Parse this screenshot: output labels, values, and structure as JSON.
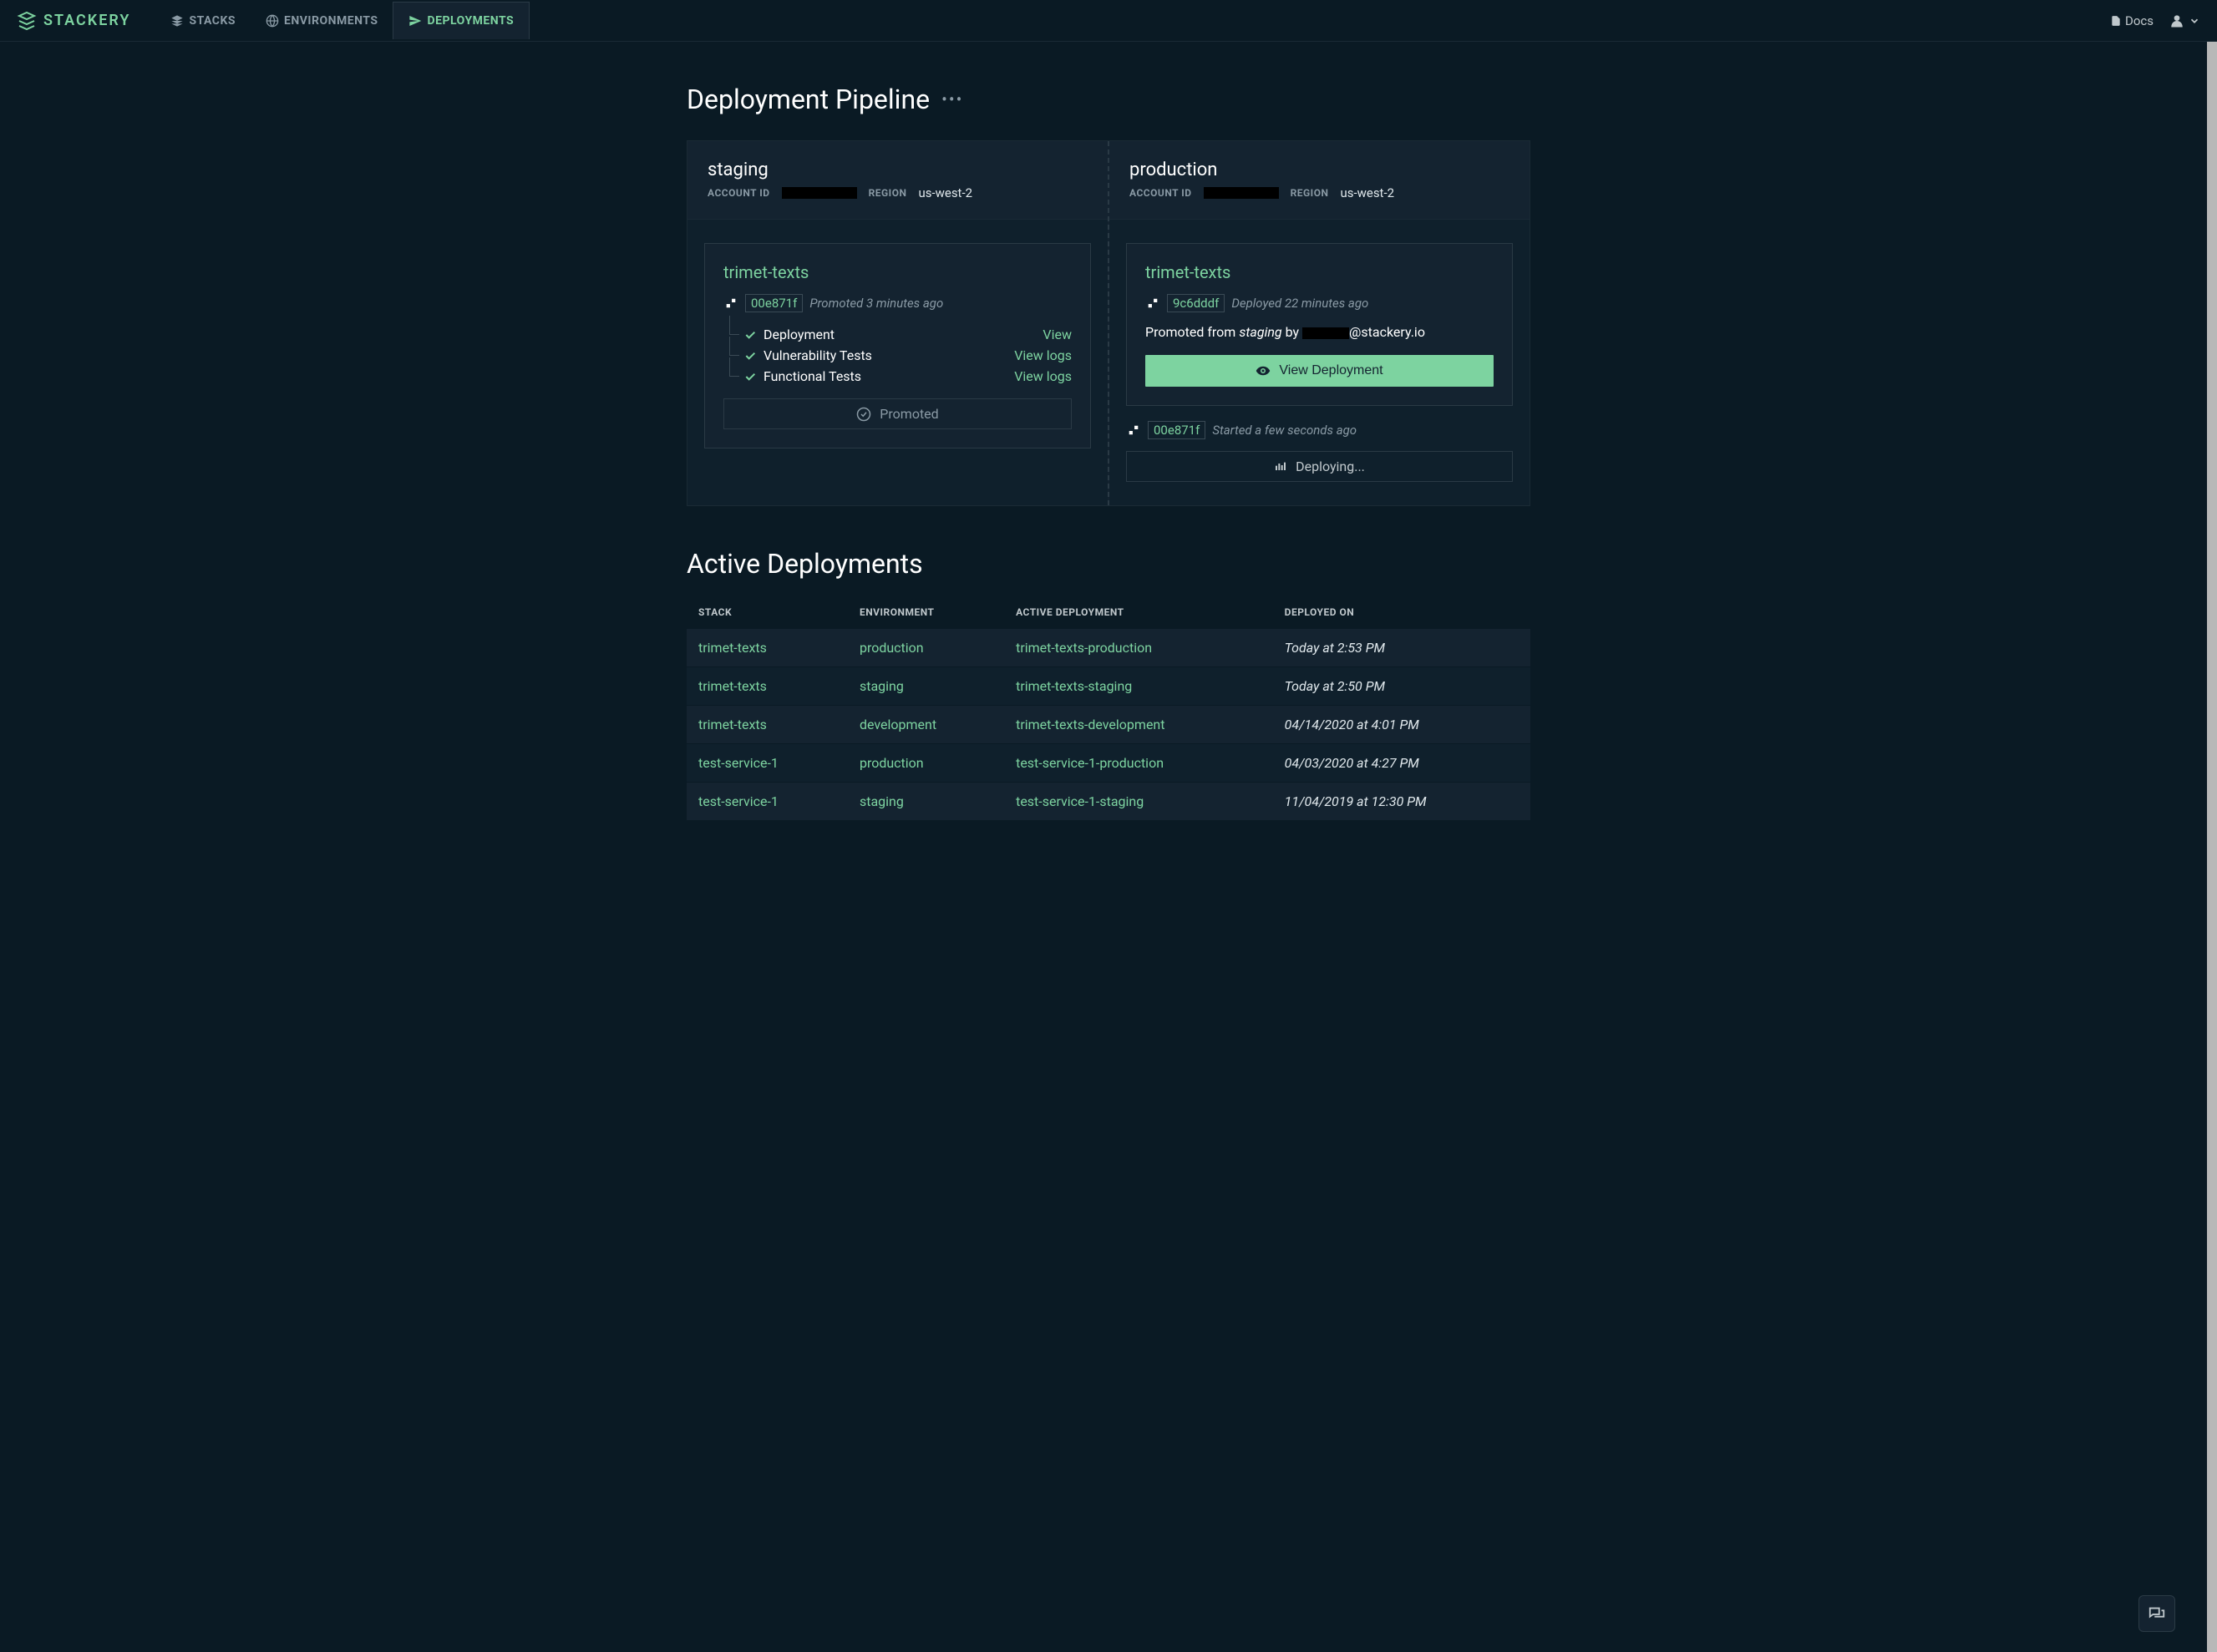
{
  "brand": "STACKERY",
  "nav": {
    "stacks": "STACKS",
    "environments": "ENVIRONMENTS",
    "deployments": "DEPLOYMENTS",
    "docs": "Docs"
  },
  "page": {
    "title": "Deployment Pipeline",
    "active_title": "Active Deployments"
  },
  "pipeline": {
    "staging": {
      "title": "staging",
      "account_label": "ACCOUNT ID",
      "region_label": "REGION",
      "region_value": "us-west-2",
      "card": {
        "title": "trimet-texts",
        "commit": "00e871f",
        "commit_meta": "Promoted 3 minutes ago",
        "checks": [
          {
            "label": "Deployment",
            "link": "View"
          },
          {
            "label": "Vulnerability Tests",
            "link": "View logs"
          },
          {
            "label": "Functional Tests",
            "link": "View logs"
          }
        ],
        "promoted_label": "Promoted"
      }
    },
    "production": {
      "title": "production",
      "account_label": "ACCOUNT ID",
      "region_label": "REGION",
      "region_value": "us-west-2",
      "card": {
        "title": "trimet-texts",
        "commit": "9c6dddf",
        "commit_meta": "Deployed 22 minutes ago",
        "promo_prefix": "Promoted from ",
        "promo_env": "staging",
        "promo_by": " by ",
        "promo_email_suffix": "@stackery.io",
        "view_deploy": "View Deployment"
      },
      "inflight": {
        "commit": "00e871f",
        "commit_meta": "Started a few seconds ago",
        "status": "Deploying..."
      }
    }
  },
  "table": {
    "headers": {
      "stack": "STACK",
      "env": "ENVIRONMENT",
      "active": "ACTIVE DEPLOYMENT",
      "deployed": "DEPLOYED ON"
    },
    "rows": [
      {
        "stack": "trimet-texts",
        "env": "production",
        "active": "trimet-texts-production",
        "deployed": "Today at 2:53 PM"
      },
      {
        "stack": "trimet-texts",
        "env": "staging",
        "active": "trimet-texts-staging",
        "deployed": "Today at 2:50 PM"
      },
      {
        "stack": "trimet-texts",
        "env": "development",
        "active": "trimet-texts-development",
        "deployed": "04/14/2020 at 4:01 PM"
      },
      {
        "stack": "test-service-1",
        "env": "production",
        "active": "test-service-1-production",
        "deployed": "04/03/2020 at 4:27 PM"
      },
      {
        "stack": "test-service-1",
        "env": "staging",
        "active": "test-service-1-staging",
        "deployed": "11/04/2019 at 12:30 PM"
      }
    ]
  }
}
